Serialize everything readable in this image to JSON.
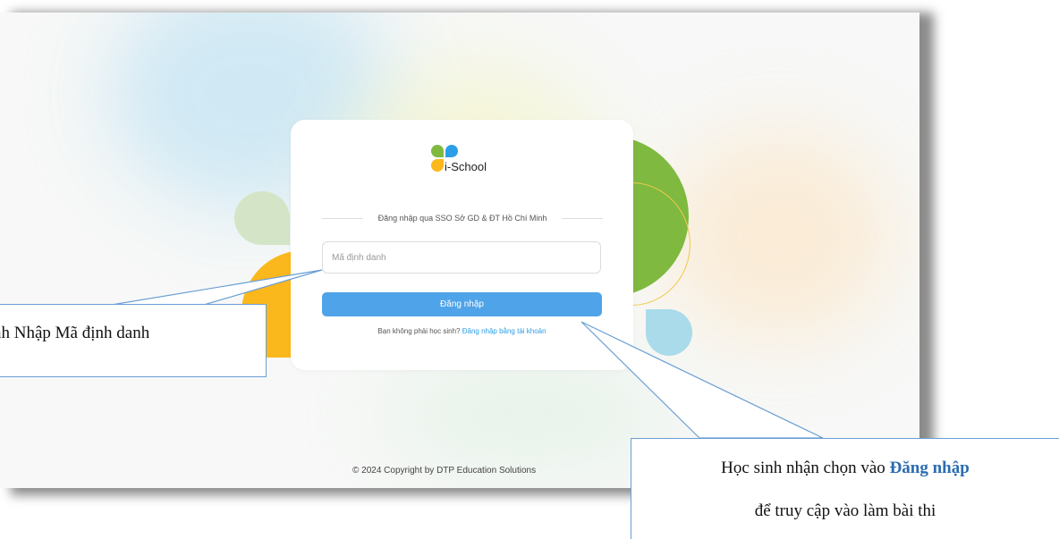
{
  "app": {
    "logo_text": "i-School"
  },
  "login": {
    "sso_label": "Đăng nhập qua SSO Sở GD & ĐT Hồ Chí Minh",
    "id_placeholder": "Mã định danh",
    "login_button": "Đăng nhập",
    "not_student_text": "Bạn không phải học sinh?",
    "alt_login_link": "Đăng nhập bằng tài khoản"
  },
  "footer": {
    "copyright": "© 2024 Copyright by DTP Education Solutions"
  },
  "annotations": {
    "left_callout": "nh Nhập Mã định danh",
    "right_callout_prefix": "Học sinh nhận chọn vào ",
    "right_callout_highlight": "Đăng nhập",
    "right_callout_line2": "để truy cập vào làm bài thi"
  },
  "colors": {
    "primary_button": "#4fa3e8",
    "link": "#2c9ee8",
    "callout_border": "#6a9fd4",
    "callout_highlight": "#2b6cb0",
    "logo_green": "#7fb940",
    "logo_blue": "#2c9ee8",
    "logo_orange": "#fbb81c"
  }
}
